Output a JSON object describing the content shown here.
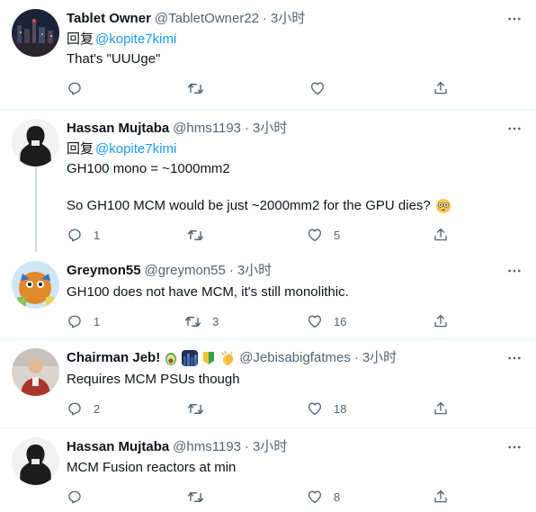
{
  "reply_prefix": "回复",
  "tweets": [
    {
      "name": "Tablet Owner",
      "handle": "@TabletOwner22",
      "time": "3小时",
      "reply_to": "@kopite7kimi",
      "lines": [
        "That's \"UUUge\""
      ],
      "counts": {
        "reply": "",
        "retweet": "",
        "like": ""
      }
    },
    {
      "name": "Hassan Mujtaba",
      "handle": "@hms1193",
      "time": "3小时",
      "reply_to": "@kopite7kimi",
      "lines": [
        "GH100 mono = ~1000mm2",
        "So GH100 MCM would be just ~2000mm2 for the GPU dies?"
      ],
      "counts": {
        "reply": "1",
        "retweet": "",
        "like": "5"
      }
    },
    {
      "name": "Greymon55",
      "handle": "@greymon55",
      "time": "3小时",
      "lines": [
        "GH100 does not have MCM, it's still monolithic."
      ],
      "counts": {
        "reply": "1",
        "retweet": "3",
        "like": "16"
      }
    },
    {
      "name": "Chairman Jeb!",
      "handle": "@Jebisabigfatmes",
      "time": "3小时",
      "lines": [
        "Requires MCM PSUs though"
      ],
      "counts": {
        "reply": "2",
        "retweet": "",
        "like": "18"
      }
    },
    {
      "name": "Hassan Mujtaba",
      "handle": "@hms1193",
      "time": "3小时",
      "lines": [
        "MCM Fusion reactors at min"
      ],
      "counts": {
        "reply": "",
        "retweet": "",
        "like": "8"
      }
    }
  ],
  "colors": {
    "link": "#1d9bf0",
    "secondary": "#536471",
    "divider": "#eff3f4",
    "thread": "#cfd9de"
  },
  "icons": [
    "reply-icon",
    "retweet-icon",
    "like-icon",
    "share-icon",
    "more-icon",
    "flushed-emoji-icon",
    "avocado-emoji-icon",
    "city-night-emoji-icon",
    "beginner-badge-emoji-icon",
    "clapping-hands-emoji-icon"
  ]
}
